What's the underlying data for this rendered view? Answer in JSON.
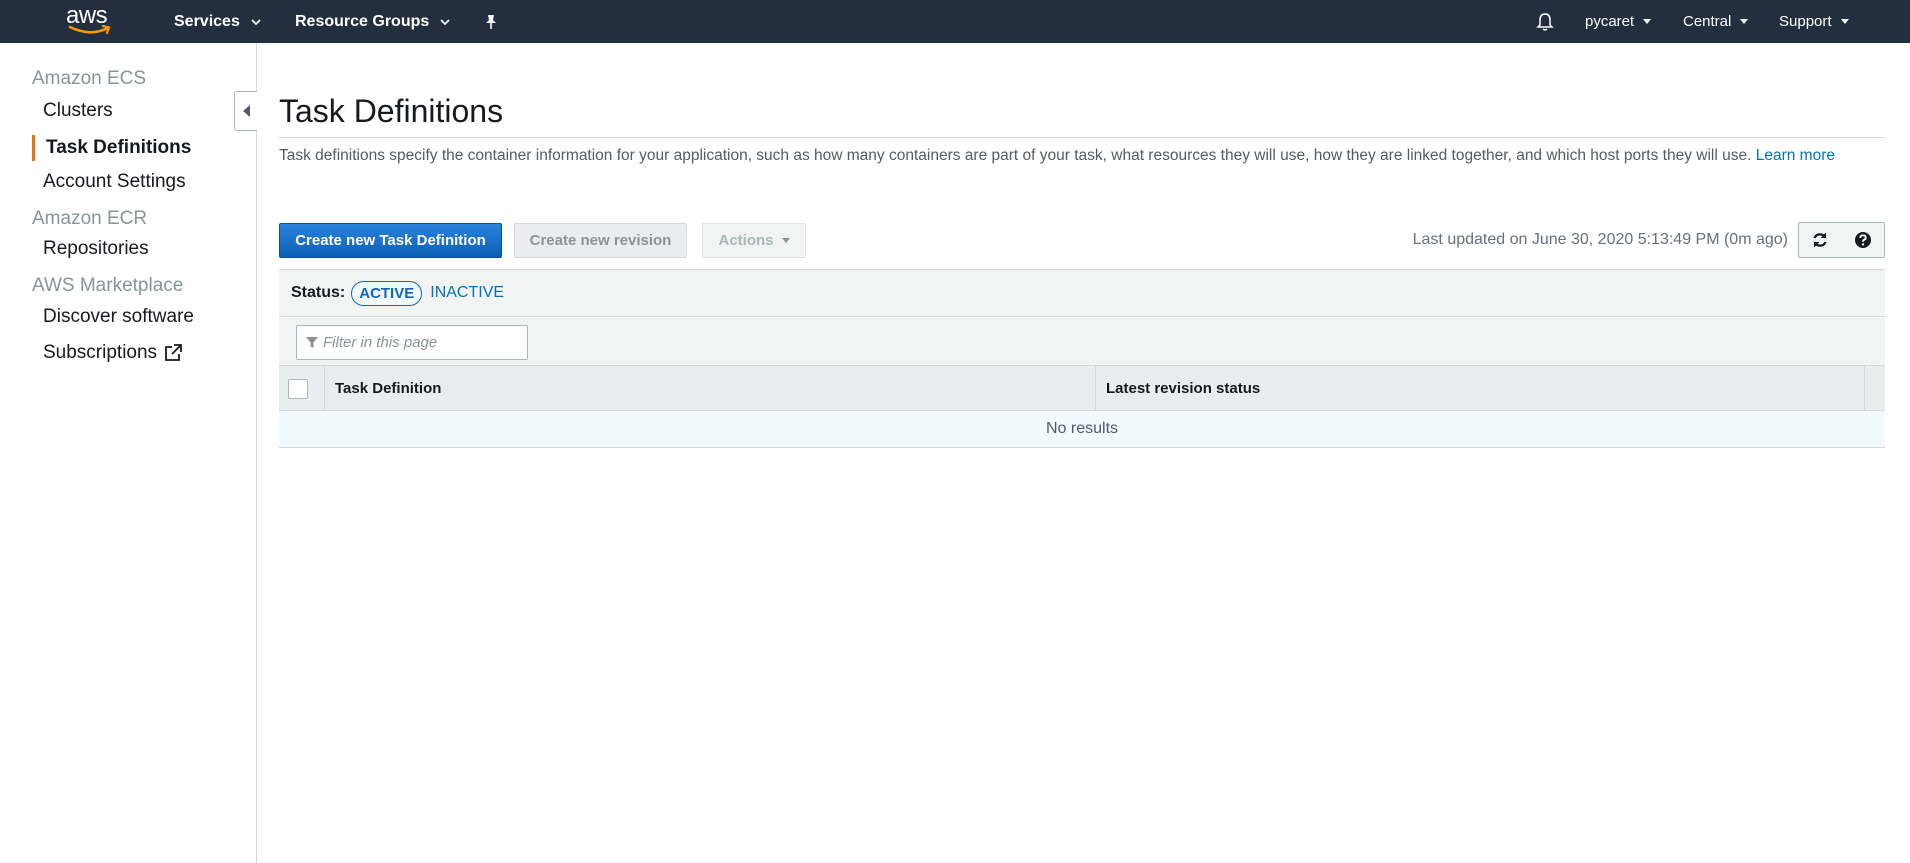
{
  "topnav": {
    "logo_text": "aws",
    "services": "Services",
    "resource_groups": "Resource Groups",
    "account": "pycaret",
    "region": "Central",
    "support": "Support"
  },
  "sidebar": {
    "sections": [
      {
        "title": "Amazon ECS",
        "items": [
          "Clusters",
          "Task Definitions",
          "Account Settings"
        ]
      },
      {
        "title": "Amazon ECR",
        "items": [
          "Repositories"
        ]
      },
      {
        "title": "AWS Marketplace",
        "items": [
          "Discover software",
          "Subscriptions"
        ]
      }
    ],
    "active_item": "Task Definitions"
  },
  "main": {
    "title": "Task Definitions",
    "description": "Task definitions specify the container information for your application, such as how many containers are part of your task, what resources they will use, how they are linked together, and which host ports they will use.",
    "learn_more": "Learn more",
    "buttons": {
      "create": "Create new Task Definition",
      "revision": "Create new revision",
      "actions": "Actions"
    },
    "last_updated": "Last updated on June 30, 2020 5:13:49 PM (0m ago)",
    "status": {
      "label": "Status:",
      "active": "ACTIVE",
      "inactive": "INACTIVE"
    },
    "filter": {
      "placeholder": "Filter in this page"
    },
    "table": {
      "columns": [
        "Task Definition",
        "Latest revision status"
      ],
      "empty": "No results"
    }
  },
  "colors": {
    "nav_bg": "#232f3e",
    "primary": "#1166bb",
    "link": "#0073bb",
    "active_marker": "#ec7211"
  }
}
